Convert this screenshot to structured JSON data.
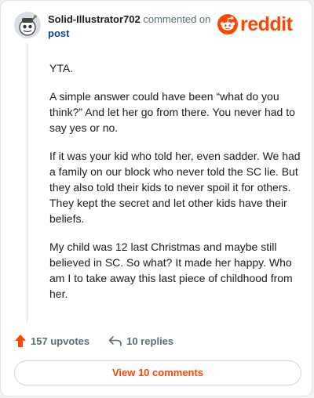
{
  "comment": {
    "username": "Solid-Illustrator702",
    "action_text": "commented on",
    "post_link": "post",
    "paragraphs": [
      "YTA.",
      "A simple answer could have been “what do you think?” And let her go from there. You never had to say yes or no.",
      "If it was your kid who told her, even sadder. We had a family on our block who never told the SC lie. But they also told their kids to never spoil it for others. They kept the secret and let other kids have their beliefs.",
      "My child was 12 last Christmas and maybe still believed in SC. So what? It made her happy. Who am I to take away this last piece of childhood from her."
    ]
  },
  "brand": {
    "name": "reddit",
    "color": "#ff4500",
    "icon": "reddit-snoo-icon"
  },
  "actions": {
    "upvotes": "157 upvotes",
    "replies": "10 replies",
    "upvote_icon": "upvote-arrow-icon",
    "reply_icon": "reply-arrow-icon"
  },
  "view_comments_label": "View 10 comments"
}
